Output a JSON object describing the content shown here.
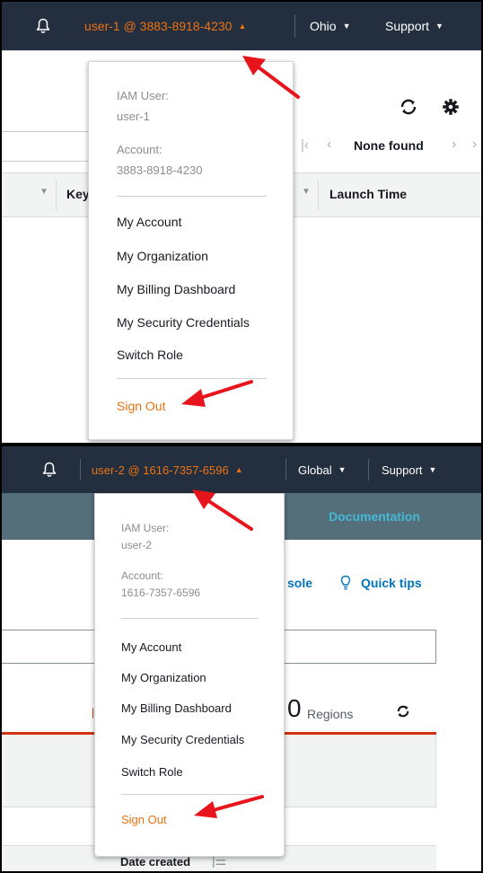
{
  "panel1": {
    "topnav": {
      "user_label": "user-1 @ 3883-8918-4230",
      "region_label": "Ohio",
      "support_label": "Support"
    },
    "menu": {
      "iam_user_label": "IAM User:",
      "iam_user_value": "user-1",
      "account_label": "Account:",
      "account_value": "3883-8918-4230",
      "items": [
        "My Account",
        "My Organization",
        "My Billing Dashboard",
        "My Security Credentials",
        "Switch Role"
      ],
      "sign_out": "Sign Out"
    },
    "background": {
      "pagination_text": "None found",
      "column_key": "Key",
      "column_launch_time": "Launch Time"
    }
  },
  "panel2": {
    "topnav": {
      "user_label": "user-2 @ 1616-7357-6596",
      "region_label": "Global",
      "support_label": "Support"
    },
    "menu": {
      "iam_user_label": "IAM User:",
      "iam_user_value": "user-2",
      "account_label": "Account:",
      "account_value": "1616-7357-6596",
      "items": [
        "My Account",
        "My Organization",
        "My Billing Dashboard",
        "My Security Credentials",
        "Switch Role"
      ],
      "sign_out": "Sign Out"
    },
    "background": {
      "documentation_link": "Documentation",
      "console_link_fragment": "sole",
      "quick_tips_link": "Quick tips",
      "regions_count": "0",
      "regions_label": "Regions",
      "date_created_header": "Date created"
    }
  },
  "colors": {
    "nav_bg": "#232f3e",
    "user_accent": "#ec7211",
    "sign_out": "#ec7211",
    "link_blue": "#0073bb",
    "secondary_nav_bg": "#546e7a",
    "error_red": "#d13212",
    "annotation_arrow": "#e8141b"
  }
}
